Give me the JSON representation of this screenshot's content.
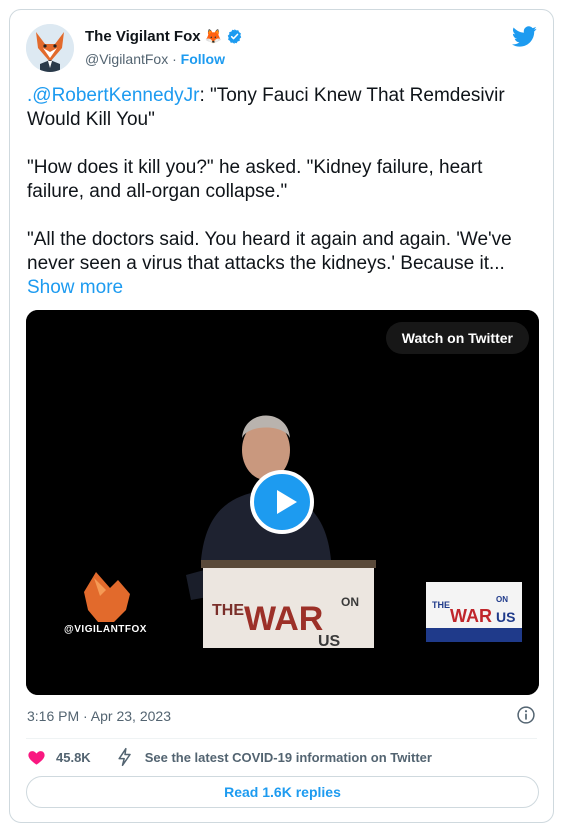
{
  "author": {
    "display_name": "The Vigilant Fox",
    "emoji": "🦊",
    "handle": "@VigilantFox",
    "separator": " · ",
    "follow_label": "Follow"
  },
  "tweet": {
    "mention": ".@RobertKennedyJr",
    "title_rest": ": \"Tony Fauci Knew That Remdesivir Would Kill You\"",
    "paragraph2": "\"How does it kill you?\" he asked. \"Kidney failure, heart failure, and all-organ collapse.\"",
    "paragraph3": "\"All the doctors said. You heard it again and again. 'We've never seen a virus that attacks the kidneys.' Because it...",
    "show_more": " Show more"
  },
  "media": {
    "watch_label": "Watch on Twitter",
    "watermark": "@VIGILANTFOX",
    "podium_text_1": "THE",
    "podium_text_2": "WAR",
    "podium_text_3": "ON",
    "podium_text_4": "US",
    "sign_text_1": "THE",
    "sign_text_2": "WAR",
    "sign_text_3": "ON",
    "sign_text_4": "US"
  },
  "meta": {
    "timestamp": "3:16 PM · Apr 23, 2023"
  },
  "actions": {
    "likes": "45.8K",
    "covid_info": "See the latest COVID-19 information on Twitter",
    "read_replies": "Read 1.6K replies"
  },
  "colors": {
    "accent": "#1d9bf0",
    "heart": "#f91880",
    "text": "#0f1419",
    "muted": "#536471"
  }
}
